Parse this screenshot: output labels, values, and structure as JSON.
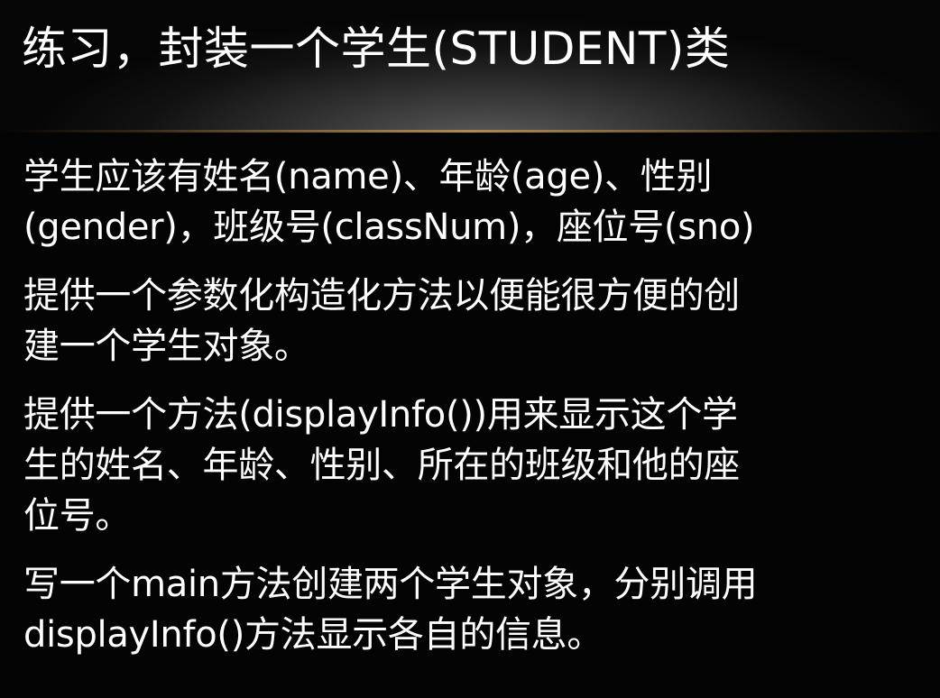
{
  "slide": {
    "title": "练习，封装一个学生(STUDENT)类",
    "paragraphs": [
      "学生应该有姓名(name)、年龄(age)、性别\n(gender)，班级号(classNum)，座位号(sno)",
      "提供一个参数化构造化方法以便能很方便的创\n建一个学生对象。",
      "提供一个方法(displayInfo())用来显示这个学\n生的姓名、年龄、性别、所在的班级和他的座\n位号。",
      "写一个main方法创建两个学生对象，分别调用\ndisplayInfo()方法显示各自的信息。"
    ]
  },
  "colors": {
    "background": "#040404",
    "text": "#ffffff",
    "divider": "#b08a4e"
  }
}
